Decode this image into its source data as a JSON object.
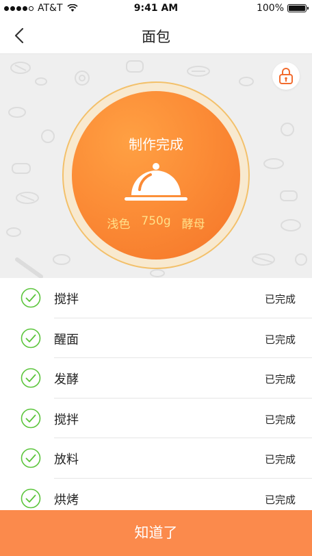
{
  "status_bar": {
    "carrier": "AT&T",
    "time": "9:41 AM",
    "battery": "100%"
  },
  "nav": {
    "title": "面包"
  },
  "hero": {
    "status": "制作完成",
    "params": {
      "color": "浅色",
      "weight": "750g",
      "leaven": "酵母"
    },
    "accent_color": "#fb8a35"
  },
  "steps": [
    {
      "name": "搅拌",
      "state": "已完成"
    },
    {
      "name": "醒面",
      "state": "已完成"
    },
    {
      "name": "发酵",
      "state": "已完成"
    },
    {
      "name": "搅拌",
      "state": "已完成"
    },
    {
      "name": "放料",
      "state": "已完成"
    },
    {
      "name": "烘烤",
      "state": "已完成"
    }
  ],
  "confirm_label": "知道了"
}
